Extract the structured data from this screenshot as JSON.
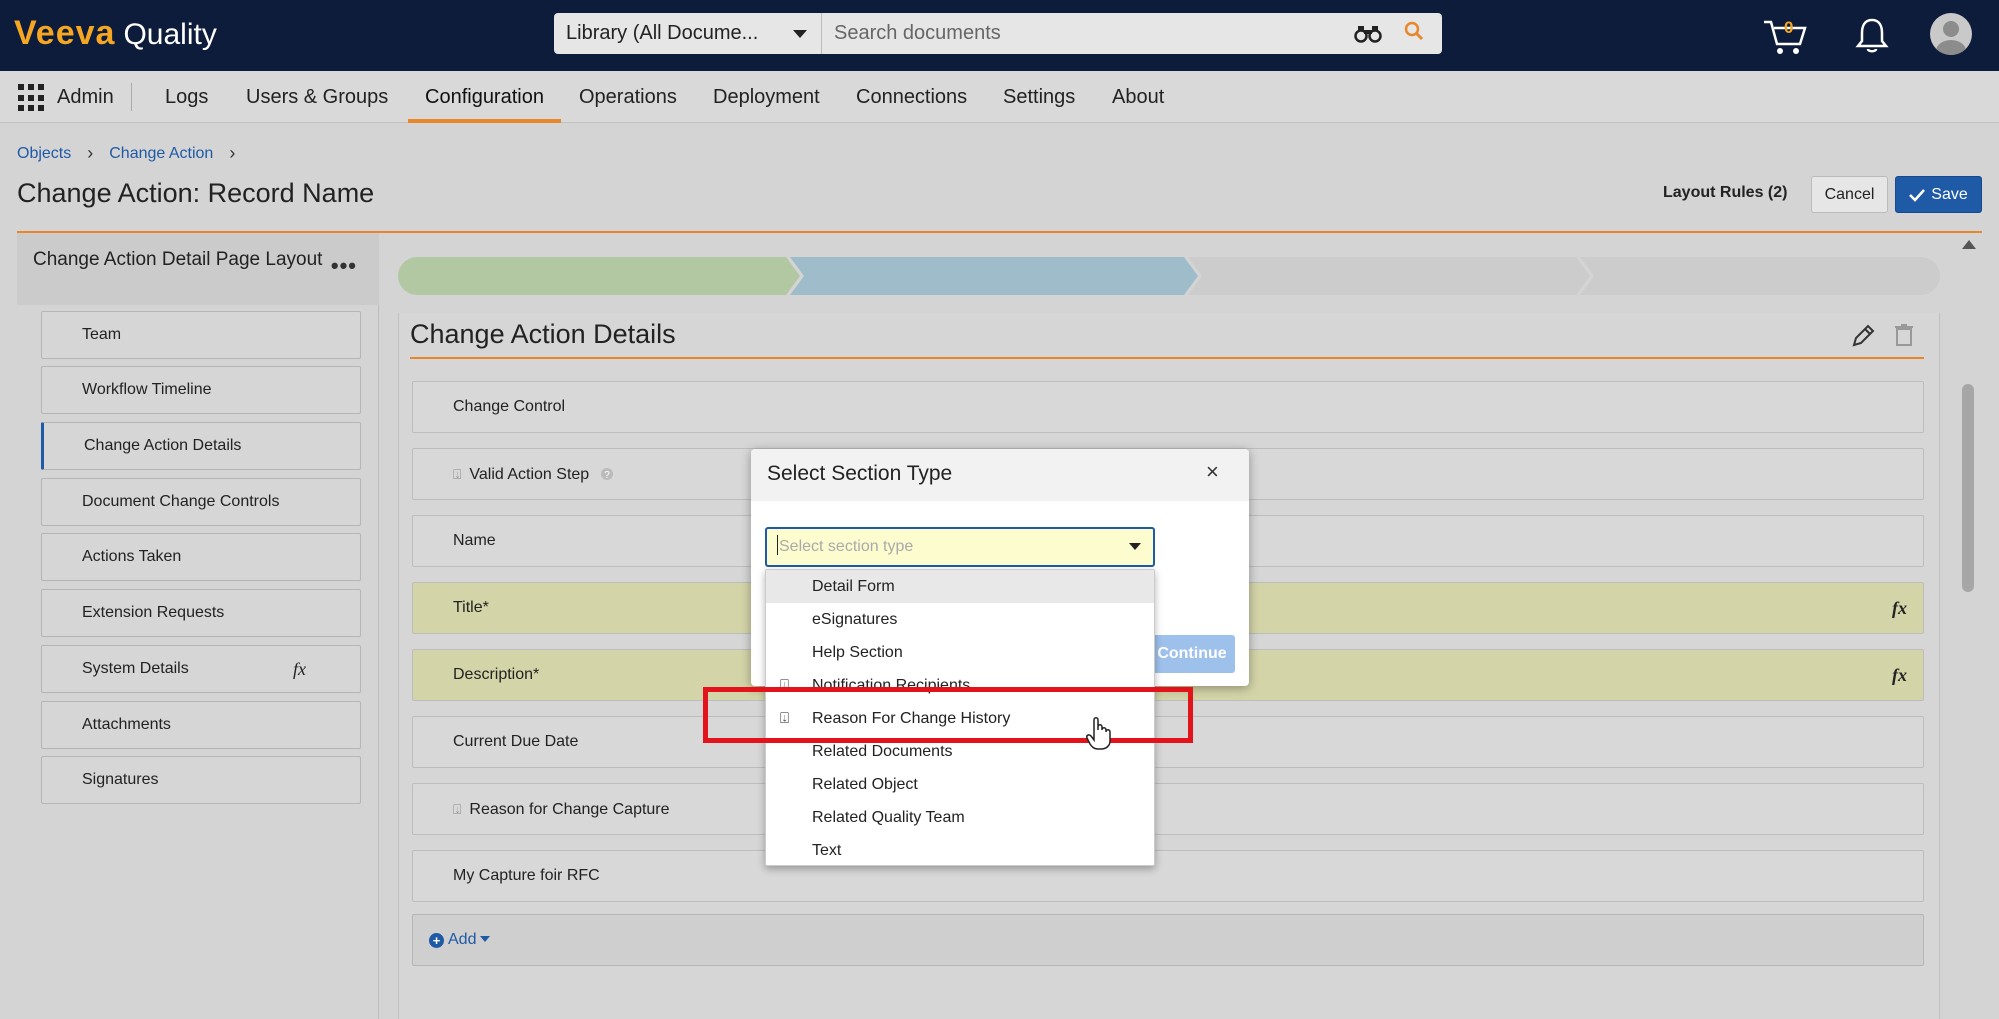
{
  "topbar": {
    "logo_brand": "Veeva",
    "logo_product": "Quality",
    "scope_select": "Library (All Docume...",
    "search_placeholder": "Search documents",
    "cart_count": "0"
  },
  "nav": {
    "admin": "Admin",
    "items": [
      "Logs",
      "Users & Groups",
      "Configuration",
      "Operations",
      "Deployment",
      "Connections",
      "Settings",
      "About"
    ],
    "active": "Configuration"
  },
  "breadcrumb": [
    "Objects",
    "Change Action"
  ],
  "page_title": "Change Action: Record Name",
  "header_actions": {
    "layout_rules": "Layout Rules (2)",
    "cancel": "Cancel",
    "save": "Save"
  },
  "left_panel": {
    "title": "Change Action Detail Page Layout",
    "menu": "•••",
    "items": [
      "Team",
      "Workflow Timeline",
      "Change Action Details",
      "Document Change Controls",
      "Actions Taken",
      "Extension Requests",
      "System Details",
      "Attachments",
      "Signatures"
    ],
    "active_item": "Change Action Details",
    "fx_label": "fx"
  },
  "section": {
    "title": "Change Action Details",
    "fields": [
      {
        "label": "Change Control",
        "style": "plain"
      },
      {
        "label": "Valid Action Step",
        "style": "plain",
        "icon": "tune-icon",
        "help": true
      },
      {
        "label": "Name",
        "style": "plain"
      },
      {
        "label": "Title*",
        "style": "yellow",
        "fx": true
      },
      {
        "label": "Description*",
        "style": "yellow",
        "fx": true
      },
      {
        "label": "Current Due Date",
        "style": "plain"
      },
      {
        "label": "Reason for Change Capture",
        "style": "plain",
        "icon": "tune-icon"
      },
      {
        "label": "My Capture foir RFC",
        "style": "plain"
      }
    ],
    "add_label": "Add",
    "fx_label": "fx"
  },
  "dialog": {
    "title": "Select Section Type",
    "close": "×",
    "select_placeholder": "Select section type",
    "continue": "Continue",
    "options": [
      "Detail Form",
      "eSignatures",
      "Help Section",
      "Notification Recipients",
      "Reason For Change History",
      "Related Documents",
      "Related Object",
      "Related Quality Team",
      "Text"
    ],
    "hovered_option": "Detail Form",
    "highlighted_option": "Reason For Change History"
  },
  "colors": {
    "topbar": "#0c1c3a",
    "accent_orange": "#e8872a",
    "primary_blue": "#1f5aa6",
    "highlight_red": "#e3131b",
    "progress_step1": "#b2c8a2",
    "progress_step2": "#9fbccb"
  }
}
